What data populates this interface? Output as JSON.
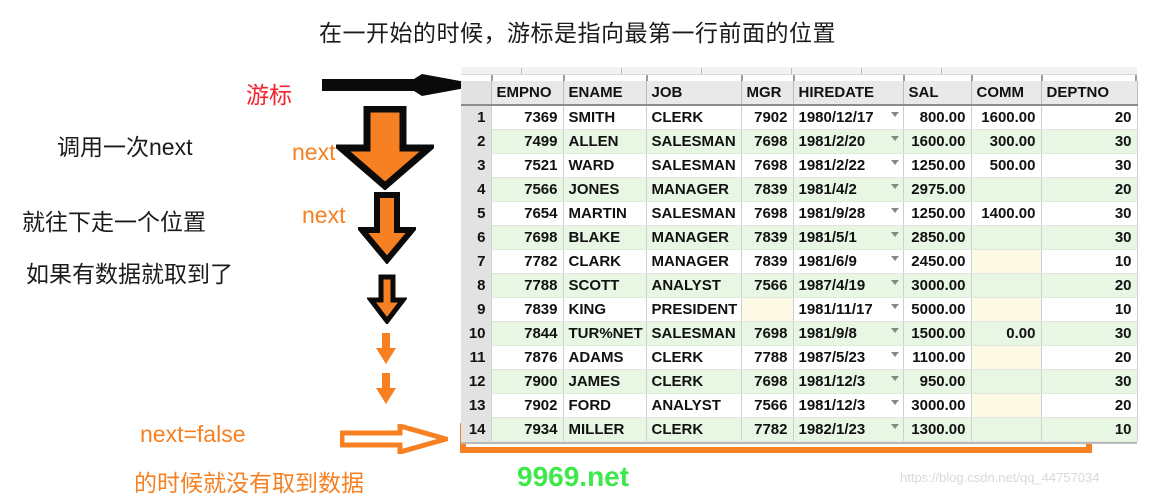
{
  "title": "在一开始的时候，游标是指向最第一行前面的位置",
  "annotations": {
    "cursor_label": "游标",
    "call_next_once": "调用一次next",
    "move_down_one": "就往下走一个位置",
    "if_has_data": "如果有数据就取到了",
    "next_1": "next",
    "next_2": "next",
    "next_false": "next=false",
    "no_data_obtained": "的时候就没有取到数据"
  },
  "watermarks": {
    "green": "9969.net",
    "gray": "https://blog.csdn.net/qq_44757034"
  },
  "colors": {
    "cursor_red": "#f5232c",
    "arrow_orange": "#f68022",
    "row_green": "#e8f6e4",
    "blank_yellow": "#fcfae4",
    "watermark_green": "#3ce84a"
  },
  "table": {
    "columns": [
      "EMPNO",
      "ENAME",
      "JOB",
      "MGR",
      "HIREDATE",
      "SAL",
      "COMM",
      "DEPTNO"
    ],
    "rows": [
      {
        "n": "1",
        "EMPNO": "7369",
        "ENAME": "SMITH",
        "JOB": "CLERK",
        "MGR": "7902",
        "HIREDATE": "1980/12/17",
        "SAL": "800.00",
        "COMM": "1600.00",
        "DEPTNO": "20"
      },
      {
        "n": "2",
        "EMPNO": "7499",
        "ENAME": "ALLEN",
        "JOB": "SALESMAN",
        "MGR": "7698",
        "HIREDATE": "1981/2/20",
        "SAL": "1600.00",
        "COMM": "300.00",
        "DEPTNO": "30"
      },
      {
        "n": "3",
        "EMPNO": "7521",
        "ENAME": "WARD",
        "JOB": "SALESMAN",
        "MGR": "7698",
        "HIREDATE": "1981/2/22",
        "SAL": "1250.00",
        "COMM": "500.00",
        "DEPTNO": "30"
      },
      {
        "n": "4",
        "EMPNO": "7566",
        "ENAME": "JONES",
        "JOB": "MANAGER",
        "MGR": "7839",
        "HIREDATE": "1981/4/2",
        "SAL": "2975.00",
        "COMM": "",
        "DEPTNO": "20"
      },
      {
        "n": "5",
        "EMPNO": "7654",
        "ENAME": "MARTIN",
        "JOB": "SALESMAN",
        "MGR": "7698",
        "HIREDATE": "1981/9/28",
        "SAL": "1250.00",
        "COMM": "1400.00",
        "DEPTNO": "30"
      },
      {
        "n": "6",
        "EMPNO": "7698",
        "ENAME": "BLAKE",
        "JOB": "MANAGER",
        "MGR": "7839",
        "HIREDATE": "1981/5/1",
        "SAL": "2850.00",
        "COMM": "",
        "DEPTNO": "30"
      },
      {
        "n": "7",
        "EMPNO": "7782",
        "ENAME": "CLARK",
        "JOB": "MANAGER",
        "MGR": "7839",
        "HIREDATE": "1981/6/9",
        "SAL": "2450.00",
        "COMM": "",
        "DEPTNO": "10"
      },
      {
        "n": "8",
        "EMPNO": "7788",
        "ENAME": "SCOTT",
        "JOB": "ANALYST",
        "MGR": "7566",
        "HIREDATE": "1987/4/19",
        "SAL": "3000.00",
        "COMM": "",
        "DEPTNO": "20"
      },
      {
        "n": "9",
        "EMPNO": "7839",
        "ENAME": "KING",
        "JOB": "PRESIDENT",
        "MGR": "",
        "HIREDATE": "1981/11/17",
        "SAL": "5000.00",
        "COMM": "",
        "DEPTNO": "10"
      },
      {
        "n": "10",
        "EMPNO": "7844",
        "ENAME": "TUR%NET",
        "JOB": "SALESMAN",
        "MGR": "7698",
        "HIREDATE": "1981/9/8",
        "SAL": "1500.00",
        "COMM": "0.00",
        "DEPTNO": "30"
      },
      {
        "n": "11",
        "EMPNO": "7876",
        "ENAME": "ADAMS",
        "JOB": "CLERK",
        "MGR": "7788",
        "HIREDATE": "1987/5/23",
        "SAL": "1100.00",
        "COMM": "",
        "DEPTNO": "20"
      },
      {
        "n": "12",
        "EMPNO": "7900",
        "ENAME": "JAMES",
        "JOB": "CLERK",
        "MGR": "7698",
        "HIREDATE": "1981/12/3",
        "SAL": "950.00",
        "COMM": "",
        "DEPTNO": "30"
      },
      {
        "n": "13",
        "EMPNO": "7902",
        "ENAME": "FORD",
        "JOB": "ANALYST",
        "MGR": "7566",
        "HIREDATE": "1981/12/3",
        "SAL": "3000.00",
        "COMM": "",
        "DEPTNO": "20"
      },
      {
        "n": "14",
        "EMPNO": "7934",
        "ENAME": "MILLER",
        "JOB": "CLERK",
        "MGR": "7782",
        "HIREDATE": "1982/1/23",
        "SAL": "1300.00",
        "COMM": "",
        "DEPTNO": "10"
      }
    ]
  }
}
